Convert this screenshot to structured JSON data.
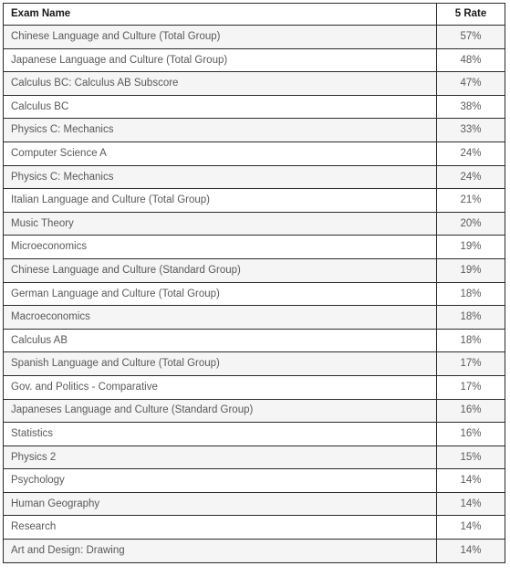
{
  "table": {
    "columns": [
      {
        "key": "exam_name",
        "label": "Exam Name",
        "align": "left"
      },
      {
        "key": "rate",
        "label": "5 Rate",
        "align": "center"
      }
    ],
    "rows": [
      {
        "exam_name": "Chinese Language and Culture (Total Group)",
        "rate": "57%"
      },
      {
        "exam_name": "Japanese Language and Culture (Total Group)",
        "rate": "48%"
      },
      {
        "exam_name": "Calculus BC: Calculus AB Subscore",
        "rate": "47%"
      },
      {
        "exam_name": "Calculus BC",
        "rate": "38%"
      },
      {
        "exam_name": "Physics C: Mechanics",
        "rate": "33%"
      },
      {
        "exam_name": "Computer Science A",
        "rate": "24%"
      },
      {
        "exam_name": "Physics C: Mechanics",
        "rate": "24%"
      },
      {
        "exam_name": "Italian Language and Culture (Total Group)",
        "rate": "21%"
      },
      {
        "exam_name": "Music Theory",
        "rate": "20%"
      },
      {
        "exam_name": "Microeconomics",
        "rate": "19%"
      },
      {
        "exam_name": "Chinese Language and Culture (Standard Group)",
        "rate": "19%"
      },
      {
        "exam_name": "German Language and Culture (Total Group)",
        "rate": "18%"
      },
      {
        "exam_name": "Macroeconomics",
        "rate": "18%"
      },
      {
        "exam_name": "Calculus AB",
        "rate": "18%"
      },
      {
        "exam_name": "Spanish Language and Culture (Total Group)",
        "rate": "17%"
      },
      {
        "exam_name": "Gov. and Politics - Comparative",
        "rate": "17%"
      },
      {
        "exam_name": "Japaneses Language and Culture (Standard Group)",
        "rate": "16%"
      },
      {
        "exam_name": "Statistics",
        "rate": "16%"
      },
      {
        "exam_name": "Physics 2",
        "rate": "15%"
      },
      {
        "exam_name": "Psychology",
        "rate": "14%"
      },
      {
        "exam_name": "Human Geography",
        "rate": "14%"
      },
      {
        "exam_name": "Research",
        "rate": "14%"
      },
      {
        "exam_name": "Art and Design: Drawing",
        "rate": "14%"
      }
    ]
  },
  "chart_data": {
    "type": "table",
    "title": "",
    "columns": [
      "Exam Name",
      "5 Rate"
    ],
    "categories": [
      "Chinese Language and Culture (Total Group)",
      "Japanese Language and Culture (Total Group)",
      "Calculus BC: Calculus AB Subscore",
      "Calculus BC",
      "Physics C: Mechanics",
      "Computer Science A",
      "Physics C: Mechanics",
      "Italian Language and Culture (Total Group)",
      "Music Theory",
      "Microeconomics",
      "Chinese Language and Culture (Standard Group)",
      "German Language and Culture (Total Group)",
      "Macroeconomics",
      "Calculus AB",
      "Spanish Language and Culture (Total Group)",
      "Gov. and Politics - Comparative",
      "Japaneses Language and Culture (Standard Group)",
      "Statistics",
      "Physics 2",
      "Psychology",
      "Human Geography",
      "Research",
      "Art and Design: Drawing"
    ],
    "values": [
      57,
      48,
      47,
      38,
      33,
      24,
      24,
      21,
      20,
      19,
      19,
      18,
      18,
      18,
      17,
      17,
      16,
      16,
      15,
      14,
      14,
      14,
      14
    ],
    "unit": "%",
    "ylabel": "5 Rate",
    "xlabel": "Exam Name"
  },
  "style": {
    "border_color": "#2b2b2b",
    "stripe_color": "#f5f5f5",
    "row_color": "#ffffff",
    "header_text_color": "#1a1a1a",
    "body_text_color": "#595959"
  }
}
